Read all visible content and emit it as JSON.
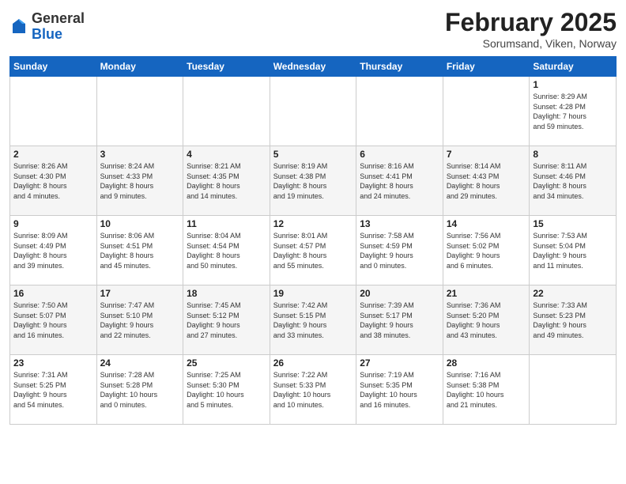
{
  "header": {
    "logo_general": "General",
    "logo_blue": "Blue",
    "title": "February 2025",
    "subtitle": "Sorumsand, Viken, Norway"
  },
  "days_of_week": [
    "Sunday",
    "Monday",
    "Tuesday",
    "Wednesday",
    "Thursday",
    "Friday",
    "Saturday"
  ],
  "weeks": [
    [
      {
        "day": "",
        "info": ""
      },
      {
        "day": "",
        "info": ""
      },
      {
        "day": "",
        "info": ""
      },
      {
        "day": "",
        "info": ""
      },
      {
        "day": "",
        "info": ""
      },
      {
        "day": "",
        "info": ""
      },
      {
        "day": "1",
        "info": "Sunrise: 8:29 AM\nSunset: 4:28 PM\nDaylight: 7 hours\nand 59 minutes."
      }
    ],
    [
      {
        "day": "2",
        "info": "Sunrise: 8:26 AM\nSunset: 4:30 PM\nDaylight: 8 hours\nand 4 minutes."
      },
      {
        "day": "3",
        "info": "Sunrise: 8:24 AM\nSunset: 4:33 PM\nDaylight: 8 hours\nand 9 minutes."
      },
      {
        "day": "4",
        "info": "Sunrise: 8:21 AM\nSunset: 4:35 PM\nDaylight: 8 hours\nand 14 minutes."
      },
      {
        "day": "5",
        "info": "Sunrise: 8:19 AM\nSunset: 4:38 PM\nDaylight: 8 hours\nand 19 minutes."
      },
      {
        "day": "6",
        "info": "Sunrise: 8:16 AM\nSunset: 4:41 PM\nDaylight: 8 hours\nand 24 minutes."
      },
      {
        "day": "7",
        "info": "Sunrise: 8:14 AM\nSunset: 4:43 PM\nDaylight: 8 hours\nand 29 minutes."
      },
      {
        "day": "8",
        "info": "Sunrise: 8:11 AM\nSunset: 4:46 PM\nDaylight: 8 hours\nand 34 minutes."
      }
    ],
    [
      {
        "day": "9",
        "info": "Sunrise: 8:09 AM\nSunset: 4:49 PM\nDaylight: 8 hours\nand 39 minutes."
      },
      {
        "day": "10",
        "info": "Sunrise: 8:06 AM\nSunset: 4:51 PM\nDaylight: 8 hours\nand 45 minutes."
      },
      {
        "day": "11",
        "info": "Sunrise: 8:04 AM\nSunset: 4:54 PM\nDaylight: 8 hours\nand 50 minutes."
      },
      {
        "day": "12",
        "info": "Sunrise: 8:01 AM\nSunset: 4:57 PM\nDaylight: 8 hours\nand 55 minutes."
      },
      {
        "day": "13",
        "info": "Sunrise: 7:58 AM\nSunset: 4:59 PM\nDaylight: 9 hours\nand 0 minutes."
      },
      {
        "day": "14",
        "info": "Sunrise: 7:56 AM\nSunset: 5:02 PM\nDaylight: 9 hours\nand 6 minutes."
      },
      {
        "day": "15",
        "info": "Sunrise: 7:53 AM\nSunset: 5:04 PM\nDaylight: 9 hours\nand 11 minutes."
      }
    ],
    [
      {
        "day": "16",
        "info": "Sunrise: 7:50 AM\nSunset: 5:07 PM\nDaylight: 9 hours\nand 16 minutes."
      },
      {
        "day": "17",
        "info": "Sunrise: 7:47 AM\nSunset: 5:10 PM\nDaylight: 9 hours\nand 22 minutes."
      },
      {
        "day": "18",
        "info": "Sunrise: 7:45 AM\nSunset: 5:12 PM\nDaylight: 9 hours\nand 27 minutes."
      },
      {
        "day": "19",
        "info": "Sunrise: 7:42 AM\nSunset: 5:15 PM\nDaylight: 9 hours\nand 33 minutes."
      },
      {
        "day": "20",
        "info": "Sunrise: 7:39 AM\nSunset: 5:17 PM\nDaylight: 9 hours\nand 38 minutes."
      },
      {
        "day": "21",
        "info": "Sunrise: 7:36 AM\nSunset: 5:20 PM\nDaylight: 9 hours\nand 43 minutes."
      },
      {
        "day": "22",
        "info": "Sunrise: 7:33 AM\nSunset: 5:23 PM\nDaylight: 9 hours\nand 49 minutes."
      }
    ],
    [
      {
        "day": "23",
        "info": "Sunrise: 7:31 AM\nSunset: 5:25 PM\nDaylight: 9 hours\nand 54 minutes."
      },
      {
        "day": "24",
        "info": "Sunrise: 7:28 AM\nSunset: 5:28 PM\nDaylight: 10 hours\nand 0 minutes."
      },
      {
        "day": "25",
        "info": "Sunrise: 7:25 AM\nSunset: 5:30 PM\nDaylight: 10 hours\nand 5 minutes."
      },
      {
        "day": "26",
        "info": "Sunrise: 7:22 AM\nSunset: 5:33 PM\nDaylight: 10 hours\nand 10 minutes."
      },
      {
        "day": "27",
        "info": "Sunrise: 7:19 AM\nSunset: 5:35 PM\nDaylight: 10 hours\nand 16 minutes."
      },
      {
        "day": "28",
        "info": "Sunrise: 7:16 AM\nSunset: 5:38 PM\nDaylight: 10 hours\nand 21 minutes."
      },
      {
        "day": "",
        "info": ""
      }
    ]
  ]
}
